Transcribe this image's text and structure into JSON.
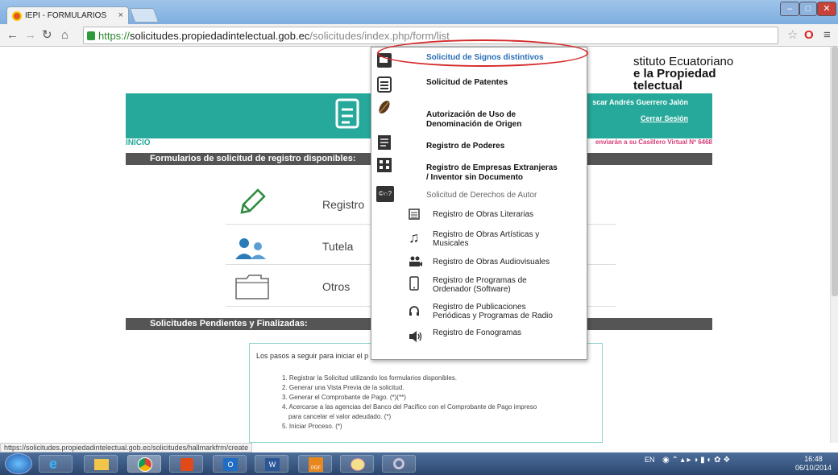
{
  "browser": {
    "tab_title": "IEPI - FORMULARIOS",
    "tab_close": "×",
    "url_scheme": "https://",
    "url_host": "solicitudes.propiedadintelectual.gob.ec",
    "url_path": "/solicitudes/index.php/form/list",
    "status_url": "https://solicitudes.propiedadintelectual.gob.ec/solicitudes/hallmarkfrm/create"
  },
  "header": {
    "logo_line1": "stituto Ecuatoriano",
    "logo_line2": "e la Propiedad",
    "logo_line3": "telectual",
    "user_name": "scar Andrés Guerrero Jalón",
    "logout": "Cerrar Sesión",
    "inicio": "INICIO",
    "casillero": "enviarán a su Casillero Virtual Nº 6468"
  },
  "main": {
    "section_forms": "Formularios de solicitud de registro disponibles:",
    "options": [
      "Registro",
      "Tutela",
      "Otros"
    ],
    "section_pending": "Solicitudes Pendientes y Finalizadas:",
    "intro": "Los pasos a seguir para iniciar el p",
    "steps": [
      "1. Registrar la Solicitud utilizando los formularios disponibles.",
      "2. Generar una Vista Previa de la solicitud.",
      "3. Generar el Comprobante de Pago. (*)(**)",
      "4. Acercarse a las agencias del Banco del Pacífico con el Comprobante de Pago impreso",
      "para cancelar el valor adeudado. (*)",
      "5. Iniciar Proceso. (*)"
    ]
  },
  "dropdown": {
    "items": [
      "Solicitud de Signos distintivos",
      "Solicitud de Patentes",
      "Autorización de Uso de\nDenominación de Origen",
      "Registro de Poderes",
      "Registro de Empresas Extranjeras\n/ Inventor sin Documento",
      "Solicitud de Derechos de Autor"
    ],
    "subitems": [
      "Registro de Obras Literarias",
      "Registro de Obras Artísticas y\nMusicales",
      "Registro de Obras Audiovisuales",
      "Registro de Programas de\nOrdenador (Software)",
      "Registro de Publicaciones\nPeriódicas y Programas de Radio",
      "Registro de Fonogramas"
    ],
    "author_icon": "©∩?"
  },
  "taskbar": {
    "lang": "EN",
    "time": "16:48",
    "date": "06/10/2014",
    "pdf_label": "PDF"
  },
  "colors": {
    "accent": "#26a99a",
    "highlight": "#d42a2a",
    "link": "#2a6fb6"
  }
}
